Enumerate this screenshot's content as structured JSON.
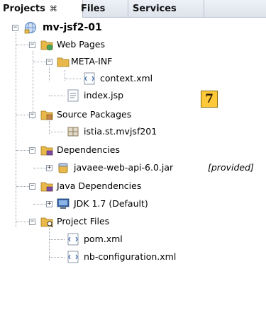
{
  "tabs": [
    {
      "label": "Projects",
      "close": "⌘"
    },
    {
      "label": "Files"
    },
    {
      "label": "Services"
    }
  ],
  "tree": {
    "project": "mv-jsf2-01",
    "web_pages": "Web Pages",
    "meta_inf": "META-INF",
    "context_xml": "context.xml",
    "index_jsp": "index.jsp",
    "source_packages": "Source Packages",
    "package": "istia.st.mvjsf201",
    "dependencies": "Dependencies",
    "javaee_jar": "javaee-web-api-6.0.jar",
    "provided": "[provided]",
    "java_dependencies": "Java Dependencies",
    "jdk": "JDK 1.7 (Default)",
    "project_files": "Project Files",
    "pom": "pom.xml",
    "nb_config": "nb-configuration.xml"
  },
  "badge": "7",
  "colors": {
    "folder": "#e8b84a",
    "badge": "#ffc93a",
    "tab_bg": "#dde3ec",
    "globe": "#6a8fc8"
  }
}
